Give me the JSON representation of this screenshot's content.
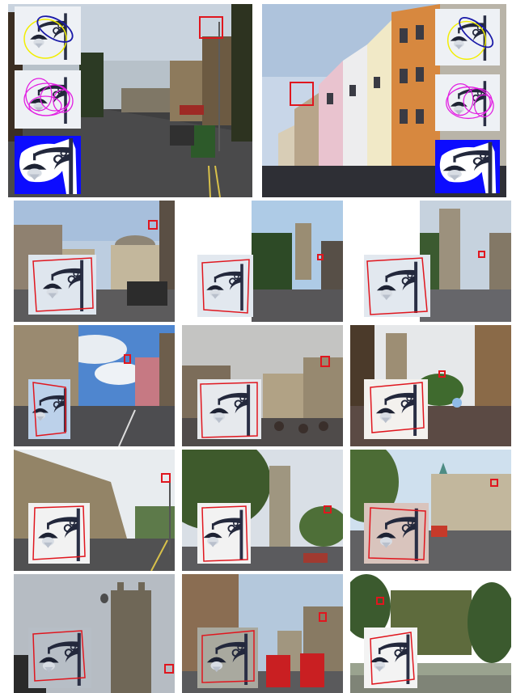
{
  "figure": {
    "panels": [
      {
        "id": "top-left",
        "scene": "street-with-lamp",
        "insets": [
          "lamp-ellipse-yellow-blue",
          "lamp-ellipse-magenta",
          "lamp-mask-blue"
        ]
      },
      {
        "id": "top-right",
        "scene": "colorful-facades",
        "insets": [
          "lamp-ellipse-yellow-blue",
          "lamp-ellipse-magenta",
          "lamp-mask-blue"
        ]
      },
      {
        "id": "r2c1",
        "scene": "domed-building-crowd"
      },
      {
        "id": "r2c2",
        "scene": "tower-sky"
      },
      {
        "id": "r2c3",
        "scene": "tower-trees"
      },
      {
        "id": "r3c1",
        "scene": "street-blue-sky"
      },
      {
        "id": "r3c2",
        "scene": "street-crowd-overcast"
      },
      {
        "id": "r3c3",
        "scene": "tower-crowd-balloons"
      },
      {
        "id": "r4c1",
        "scene": "street-perspective"
      },
      {
        "id": "r4c2",
        "scene": "tower-tree-left"
      },
      {
        "id": "r4c3",
        "scene": "square-with-bus"
      },
      {
        "id": "r5c1",
        "scene": "tower-grey-sky"
      },
      {
        "id": "r5c2",
        "scene": "street-red-buses"
      },
      {
        "id": "r5c3",
        "scene": "ivy-building"
      }
    ],
    "colors": {
      "highlight_box": "#e0161e",
      "ellipse_yellow": "#f2ee00",
      "ellipse_blue": "#1a1aa8",
      "ellipse_magenta": "#e21ee2",
      "mask_blue": "#0c0cff",
      "lamp_dark": "#1d2233"
    }
  }
}
